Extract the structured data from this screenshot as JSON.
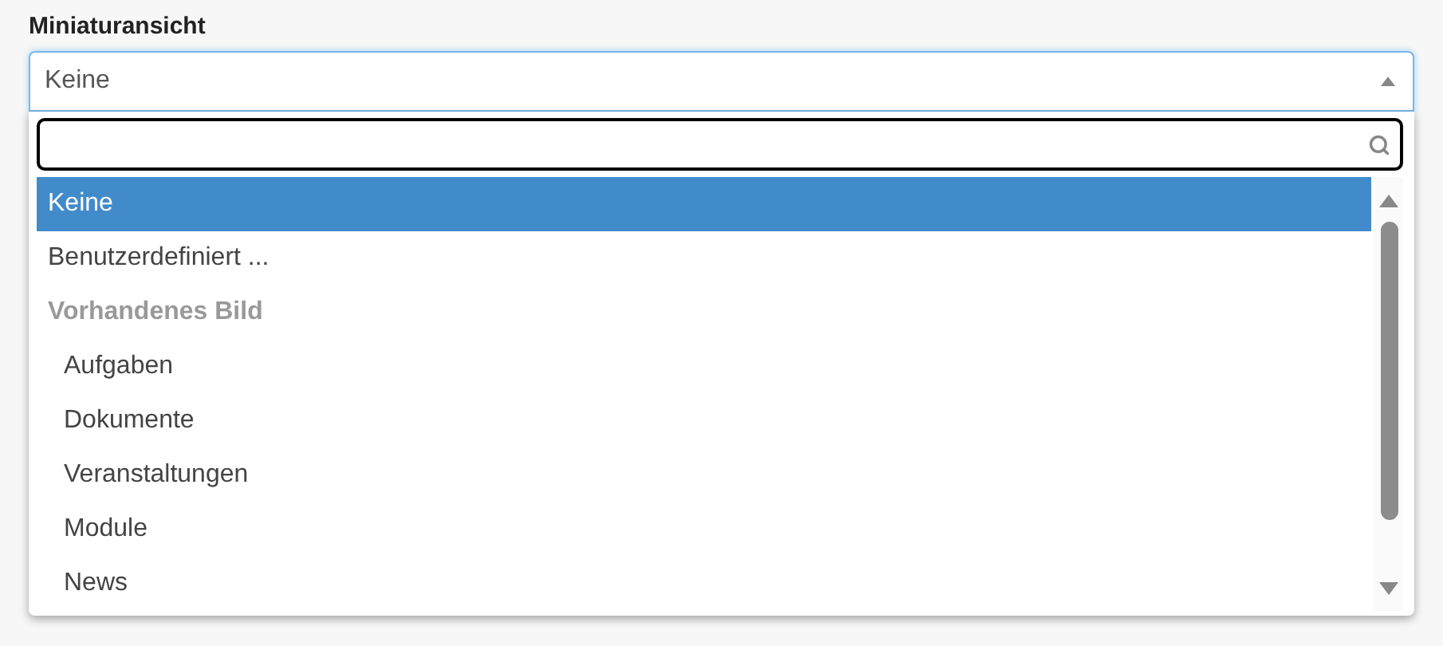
{
  "label": "Miniaturansicht",
  "select": {
    "value": "Keine",
    "expanded": true
  },
  "options": [
    {
      "kind": "option",
      "label": "Keine",
      "selected": true
    },
    {
      "kind": "option",
      "label": "Benutzerdefiniert ...",
      "selected": false
    },
    {
      "kind": "group",
      "label": "Vorhandenes Bild"
    },
    {
      "kind": "child",
      "label": "Aufgaben",
      "selected": false
    },
    {
      "kind": "child",
      "label": "Dokumente",
      "selected": false
    },
    {
      "kind": "child",
      "label": "Veranstaltungen",
      "selected": false
    },
    {
      "kind": "child",
      "label": "Module",
      "selected": false
    },
    {
      "kind": "child",
      "label": "News",
      "selected": false
    }
  ]
}
